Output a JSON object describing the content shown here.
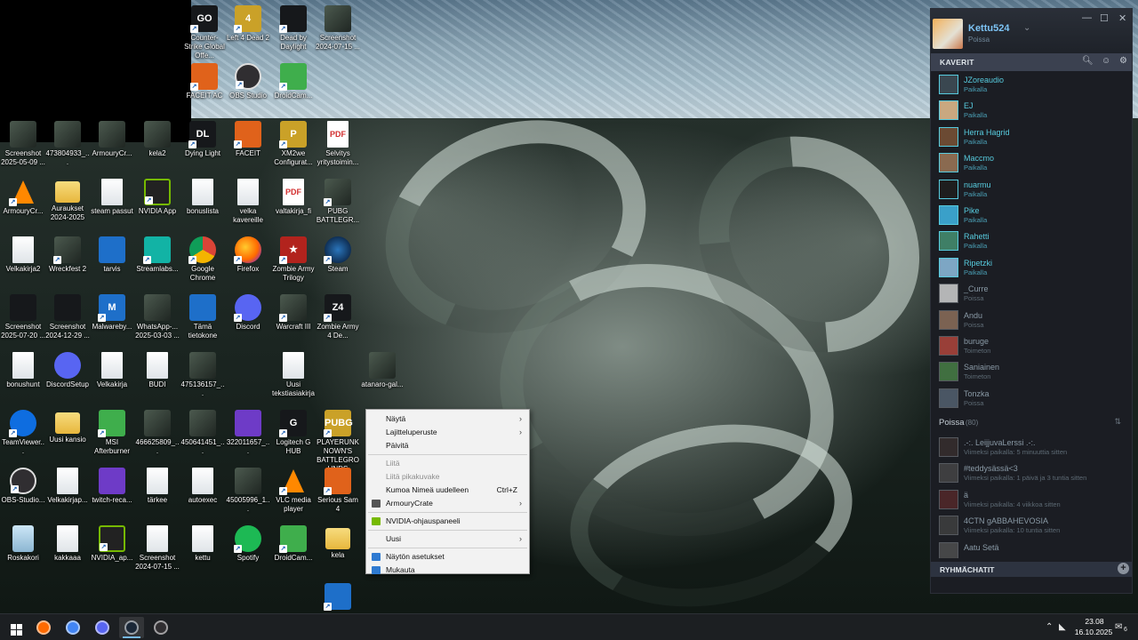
{
  "desktop_icons": [
    {
      "id": "csgo",
      "label": "Counter-Strike Global Offe...",
      "label_display": "unter-Str...\nobal Offe...",
      "icon_text": "GO"
    },
    {
      "id": "l4d2",
      "label": "Left 4 Dead 2",
      "icon_text": "4"
    },
    {
      "id": "dbd",
      "label": "Dead by Daylight",
      "icon_text": ""
    },
    {
      "id": "screenshot1",
      "label": "Screenshot 2024-07-15 ...",
      "icon_text": ""
    },
    {
      "id": "faceit_ac",
      "label": "FACEIT AC",
      "icon_text": ""
    },
    {
      "id": "obs",
      "label": "OBS Studio",
      "icon_text": ""
    },
    {
      "id": "droidcam1",
      "label": "DroidCam...",
      "icon_text": ""
    },
    {
      "id": "screenshot2",
      "label": "Screenshot 2025-05-09 ...",
      "icon_text": ""
    },
    {
      "id": "f473804933",
      "label": "473804933_...",
      "icon_text": ""
    },
    {
      "id": "armourycr1",
      "label": "ArmouryCr...",
      "icon_text": ""
    },
    {
      "id": "kela2",
      "label": "kela2",
      "icon_text": ""
    },
    {
      "id": "dyinglight",
      "label": "Dying Light",
      "icon_text": "DL"
    },
    {
      "id": "faceit",
      "label": "FACEIT",
      "icon_text": ""
    },
    {
      "id": "xm2we",
      "label": "XM2we Configurat...",
      "icon_text": "P"
    },
    {
      "id": "selvitys",
      "label": "Selvitys yritystoimin...",
      "icon_text": "PDF"
    },
    {
      "id": "armourycr2",
      "label": "ArmouryCr...",
      "icon_text": ""
    },
    {
      "id": "auraukset",
      "label": "Auraukset 2024-2025",
      "icon_text": ""
    },
    {
      "id": "steampassut",
      "label": "steam passut",
      "icon_text": ""
    },
    {
      "id": "nvidiaapp",
      "label": "NVIDIA App",
      "icon_text": ""
    },
    {
      "id": "bonuslista",
      "label": "bonuslista",
      "icon_text": ""
    },
    {
      "id": "velka",
      "label": "velka kavereille",
      "icon_text": ""
    },
    {
      "id": "valtakirja",
      "label": "valtakirja_fi",
      "icon_text": "PDF"
    },
    {
      "id": "pubg1",
      "label": "PUBG BATTLEGR...",
      "icon_text": ""
    },
    {
      "id": "velkakirja2",
      "label": "Velkakirja2",
      "icon_text": ""
    },
    {
      "id": "wreckfest",
      "label": "Wreckfest 2",
      "icon_text": ""
    },
    {
      "id": "tarvis",
      "label": "tarvis",
      "icon_text": ""
    },
    {
      "id": "streamlabs",
      "label": "Streamlabs...",
      "icon_text": ""
    },
    {
      "id": "chrome",
      "label": "Google Chrome",
      "icon_text": ""
    },
    {
      "id": "firefox",
      "label": "Firefox",
      "icon_text": ""
    },
    {
      "id": "zombiearmy",
      "label": "Zombie Army Trilogy",
      "icon_text": "★"
    },
    {
      "id": "steam",
      "label": "Steam",
      "icon_text": ""
    },
    {
      "id": "screenshot3",
      "label": "Screenshot 2025-07-20 ...",
      "icon_text": ""
    },
    {
      "id": "screenshot4",
      "label": "Screenshot 2024-12-29 ...",
      "icon_text": ""
    },
    {
      "id": "malwarebytes",
      "label": "Malwareby...",
      "icon_text": "M"
    },
    {
      "id": "whatsapp",
      "label": "WhatsApp-... 2025-03-03 ...",
      "icon_text": ""
    },
    {
      "id": "tamatietokone",
      "label": "Tämä tietokone",
      "icon_text": ""
    },
    {
      "id": "discord1",
      "label": "Discord",
      "icon_text": ""
    },
    {
      "id": "warcraft",
      "label": "Warcraft III",
      "icon_text": ""
    },
    {
      "id": "zombiearmy4",
      "label": "Zombie Army 4 De...",
      "icon_text": "Z4"
    },
    {
      "id": "bonushunt",
      "label": "bonushunt",
      "icon_text": ""
    },
    {
      "id": "discordsetup",
      "label": "DiscordSetup",
      "icon_text": ""
    },
    {
      "id": "velkakirja",
      "label": "Velkakirja",
      "icon_text": ""
    },
    {
      "id": "budi",
      "label": "BUDI",
      "icon_text": ""
    },
    {
      "id": "f475136157",
      "label": "475136157_...",
      "icon_text": ""
    },
    {
      "id": "uusiteksti",
      "label": "Uusi tekstiasiakirja",
      "icon_text": ""
    },
    {
      "id": "atanaro",
      "label": "atanaro-gal...",
      "icon_text": ""
    },
    {
      "id": "teamviewer",
      "label": "TeamViewer...",
      "icon_text": ""
    },
    {
      "id": "uusikansio",
      "label": "Uusi kansio",
      "icon_text": ""
    },
    {
      "id": "msiab",
      "label": "MSI Afterburner",
      "icon_text": ""
    },
    {
      "id": "f466625809",
      "label": "466625809_...",
      "icon_text": ""
    },
    {
      "id": "f450641451",
      "label": "450641451_...",
      "icon_text": ""
    },
    {
      "id": "f322011657",
      "label": "322011657_...",
      "icon_text": ""
    },
    {
      "id": "logitech",
      "label": "Logitech G HUB",
      "icon_text": "G"
    },
    {
      "id": "pubg2",
      "label": "PLAYERUNKNOWN'S BATTLEGROUNDS",
      "label_display": "PLAYERUNK NOWN'S BATTLEGROU NDS",
      "icon_text": "PUBG"
    },
    {
      "id": "obsstudio2",
      "label": "OBS-Studio...",
      "icon_text": ""
    },
    {
      "id": "velkakirjap",
      "label": "Velkakirjap...",
      "icon_text": ""
    },
    {
      "id": "twitchreca",
      "label": "twitch-reca...",
      "icon_text": ""
    },
    {
      "id": "tarkee",
      "label": "tärkee",
      "icon_text": ""
    },
    {
      "id": "autoexec",
      "label": "autoexec",
      "icon_text": ""
    },
    {
      "id": "f450059961",
      "label": "45005996_1...",
      "icon_text": ""
    },
    {
      "id": "vlc",
      "label": "VLC media player",
      "icon_text": ""
    },
    {
      "id": "serioussam",
      "label": "Serious Sam 4",
      "icon_text": ""
    },
    {
      "id": "roskakori",
      "label": "Roskakori",
      "icon_text": ""
    },
    {
      "id": "kakkaaa",
      "label": "kakkaaa",
      "icon_text": ""
    },
    {
      "id": "nvidiaap",
      "label": "NVIDIA_ap...",
      "icon_text": ""
    },
    {
      "id": "screenshot5",
      "label": "Screenshot 2024-07-15 ...",
      "icon_text": ""
    },
    {
      "id": "kettu",
      "label": "kettu",
      "icon_text": ""
    },
    {
      "id": "spotify",
      "label": "Spotify",
      "icon_text": ""
    },
    {
      "id": "droidcam2",
      "label": "DroidCam...",
      "icon_text": ""
    },
    {
      "id": "kela",
      "label": "kela",
      "icon_text": ""
    },
    {
      "id": "cs2",
      "label": "",
      "icon_text": ""
    }
  ],
  "context_menu": {
    "items": [
      {
        "label": "Näytä",
        "submenu": true,
        "disabled": false,
        "shortcut": "",
        "icon": "",
        "icon_color": ""
      },
      {
        "label": "Lajitteluperuste",
        "submenu": true,
        "disabled": false,
        "shortcut": "",
        "icon": "",
        "icon_color": ""
      },
      {
        "label": "Päivitä",
        "submenu": false,
        "disabled": false,
        "shortcut": "",
        "icon": "",
        "icon_color": ""
      },
      {
        "separator": true
      },
      {
        "label": "Liitä",
        "submenu": false,
        "disabled": true,
        "shortcut": "",
        "icon": "",
        "icon_color": ""
      },
      {
        "label": "Liitä pikakuvake",
        "submenu": false,
        "disabled": true,
        "shortcut": "",
        "icon": "",
        "icon_color": ""
      },
      {
        "label": "Kumoa Nimeä uudelleen",
        "submenu": false,
        "disabled": false,
        "shortcut": "Ctrl+Z",
        "icon": "",
        "icon_color": ""
      },
      {
        "label": "ArmouryCrate",
        "submenu": true,
        "disabled": false,
        "shortcut": "",
        "icon": "armourycrate-icon",
        "icon_color": "#555555"
      },
      {
        "separator": true
      },
      {
        "label": "NVIDIA-ohjauspaneeli",
        "submenu": false,
        "disabled": false,
        "shortcut": "",
        "icon": "nvidia-icon",
        "icon_color": "#76b900"
      },
      {
        "separator": true
      },
      {
        "label": "Uusi",
        "submenu": true,
        "disabled": false,
        "shortcut": "",
        "icon": "",
        "icon_color": ""
      },
      {
        "separator": true
      },
      {
        "label": "Näytön asetukset",
        "submenu": false,
        "disabled": false,
        "shortcut": "",
        "icon": "display-settings-icon",
        "icon_color": "#2e7ad1"
      },
      {
        "label": "Mukauta",
        "submenu": false,
        "disabled": false,
        "shortcut": "",
        "icon": "personalize-icon",
        "icon_color": "#2e7ad1"
      }
    ],
    "arrow_glyph": "›"
  },
  "steam": {
    "username": "Kettu524",
    "user_status": "Poissa",
    "chevron": "⌄",
    "window_controls": {
      "minimize": "—",
      "maximize": "☐",
      "close": "✕"
    },
    "friends_bar_title": "KAVERIT",
    "online_friends": [
      {
        "name": "JZoreaudio",
        "status": "Paikalla",
        "avatar_color": "#3a4750"
      },
      {
        "name": "EJ",
        "status": "Paikalla",
        "avatar_color": "#c9a880"
      },
      {
        "name": "Herra Hagrid",
        "status": "Paikalla",
        "avatar_color": "#6b4a33"
      },
      {
        "name": "Maccmo",
        "status": "Paikalla",
        "avatar_color": "#8a6a50"
      },
      {
        "name": "nuarmu",
        "status": "Paikalla",
        "avatar_color": "#1e1e1e"
      },
      {
        "name": "Pike",
        "status": "Paikalla",
        "avatar_color": "#3aa0c9"
      },
      {
        "name": "Rahetti",
        "status": "Paikalla",
        "avatar_color": "#3f7f66"
      },
      {
        "name": "Ripetzki",
        "status": "Paikalla",
        "avatar_color": "#7da6c4"
      },
      {
        "name": "_Curre",
        "status": "Poissa",
        "avatar_color": "#e8e8e8"
      },
      {
        "name": "Andu",
        "status": "Poissa",
        "avatar_color": "#9c7a62"
      },
      {
        "name": "buruge",
        "status": "Toimeton",
        "avatar_color": "#c44b3f"
      },
      {
        "name": "Saniainen",
        "status": "Toimeton",
        "avatar_color": "#4d8b4a"
      },
      {
        "name": "Tonzka",
        "status": "Poissa",
        "avatar_color": "#5a6a7a"
      }
    ],
    "offline_label": "Poissa",
    "offline_count": "(80)",
    "offline_friends": [
      {
        "name": ".-:. LeijjuvaLerssi .-:.",
        "status": "Viimeksi paikalla: 5 minuuttia sitten",
        "avatar_color": "#3a3030"
      },
      {
        "name": "#teddysässä<3",
        "status": "Viimeksi paikalla: 1 päivä ja 3 tuntia sitten",
        "avatar_color": "#4a4a4a"
      },
      {
        "name": "ä",
        "status": "Viimeksi paikalla: 4 viikkoa sitten",
        "avatar_color": "#5a2a2a"
      },
      {
        "name": "4CTN gABBAHEVOSIA",
        "status": "Viimeksi paikalla: 10 tuntia sitten",
        "avatar_color": "#444"
      },
      {
        "name": "Aatu Setä",
        "status": "",
        "avatar_color": "#555"
      }
    ],
    "group_chats_title": "RYHMÄCHATIT"
  },
  "taskbar": {
    "time": "23.08",
    "date": "16.10.2025",
    "notification_count": "6",
    "apps": [
      {
        "name": "firefox",
        "color": "#ff6a00",
        "active": false
      },
      {
        "name": "chrome",
        "color": "#4285f4",
        "active": false
      },
      {
        "name": "discord",
        "color": "#5865f2",
        "active": false
      },
      {
        "name": "steam",
        "color": "#1b2838",
        "active": true
      },
      {
        "name": "obs",
        "color": "#302e31",
        "active": false
      }
    ]
  }
}
